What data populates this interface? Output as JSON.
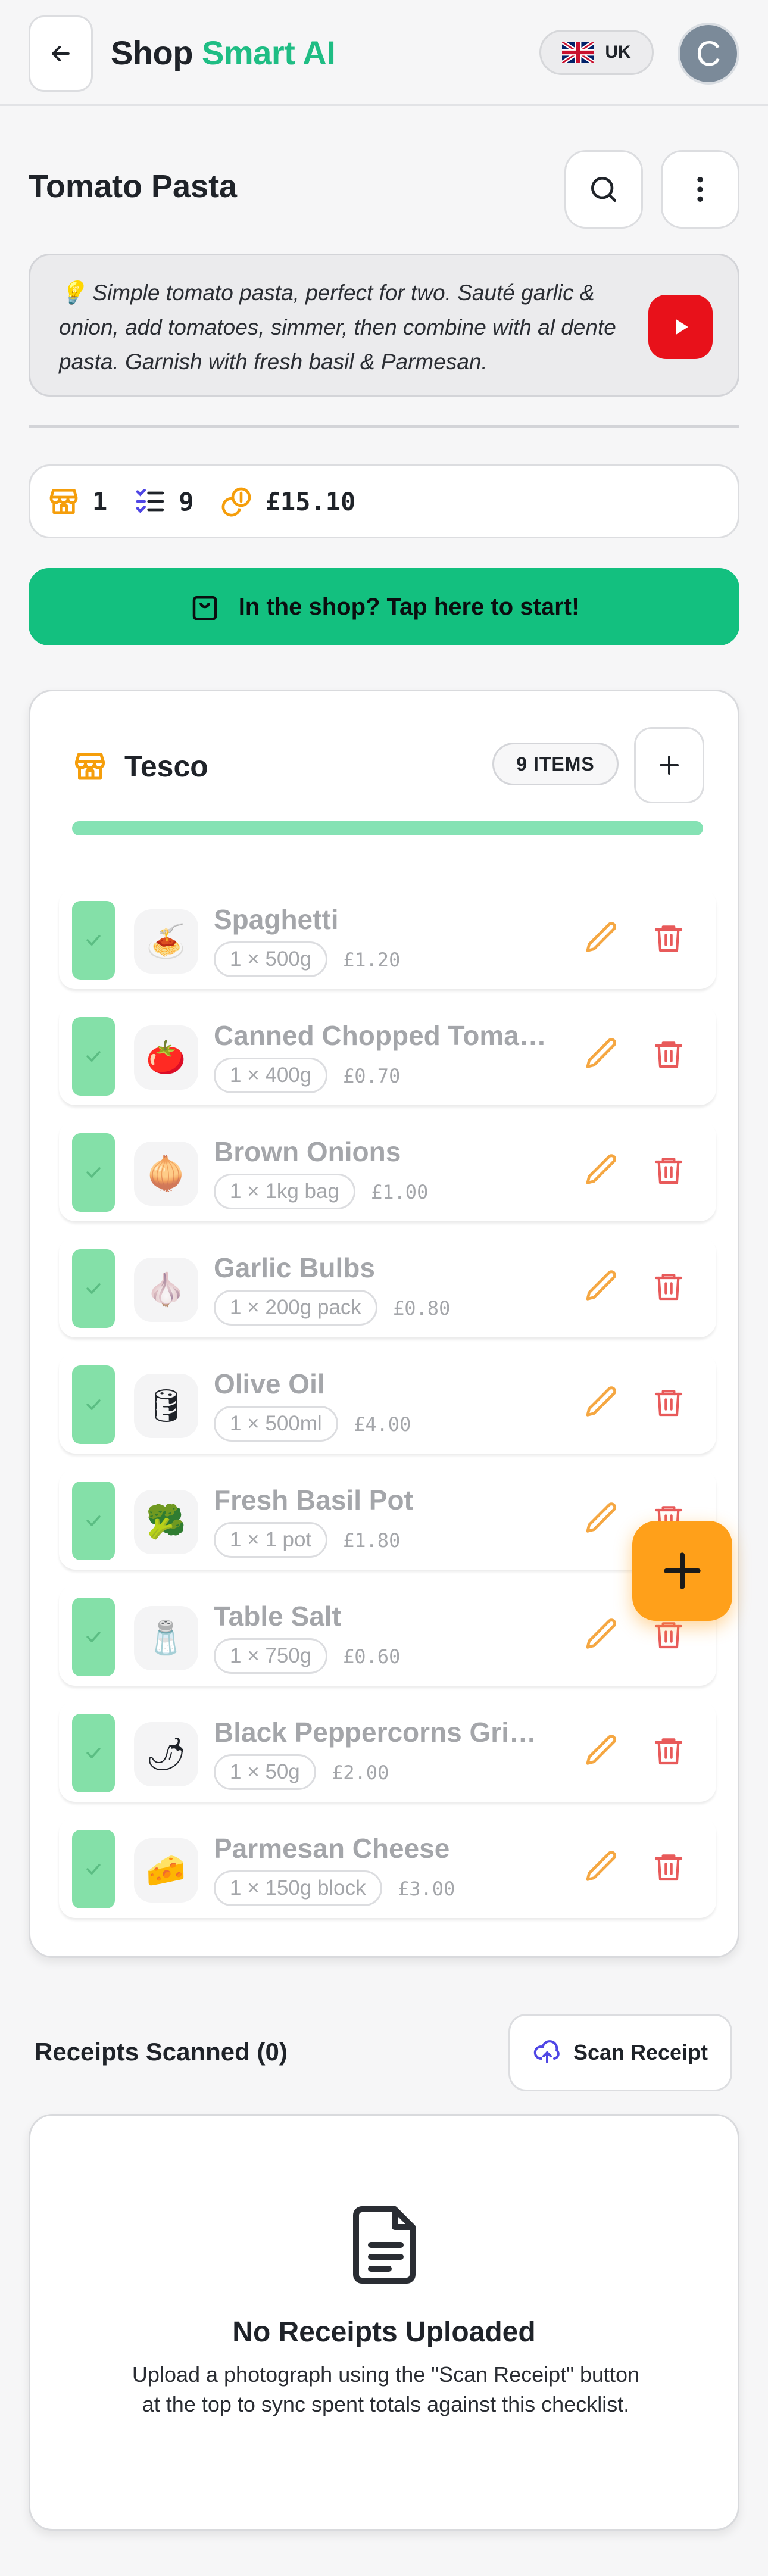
{
  "header": {
    "brand_main": "Shop",
    "brand_accent": "Smart AI",
    "country": "UK",
    "avatar_initial": "C"
  },
  "recipe": {
    "title": "Tomato Pasta",
    "description_icon": "lightbulb-icon",
    "description": "Simple tomato pasta, perfect for two. Sauté garlic & onion, add tomatoes, simmer, then combine with al dente pasta. Garnish with fresh basil & Parmesan."
  },
  "stats": {
    "shops": "1",
    "items": "9",
    "total": "£15.10"
  },
  "start_button": {
    "label": "In the shop? Tap here to start!"
  },
  "shop": {
    "name": "Tesco",
    "items_badge": "9 ITEMS",
    "progress": 1.0,
    "items": [
      {
        "name": "Spaghetti",
        "qty": "1 × 500g",
        "price": "£1.20",
        "emoji": "🍝",
        "checked": true
      },
      {
        "name": "Canned Chopped Tomatoes",
        "qty": "1 × 400g",
        "price": "£0.70",
        "emoji": "🍅",
        "checked": true
      },
      {
        "name": "Brown Onions",
        "qty": "1 × 1kg bag",
        "price": "£1.00",
        "emoji": "🧅",
        "checked": true
      },
      {
        "name": "Garlic Bulbs",
        "qty": "1 × 200g pack",
        "price": "£0.80",
        "emoji": "🧄",
        "checked": true
      },
      {
        "name": "Olive Oil",
        "qty": "1 × 500ml",
        "price": "£4.00",
        "emoji": "🛢",
        "checked": true
      },
      {
        "name": "Fresh Basil Pot",
        "qty": "1 × 1 pot",
        "price": "£1.80",
        "emoji": "🥦",
        "checked": true
      },
      {
        "name": "Table Salt",
        "qty": "1 × 750g",
        "price": "£0.60",
        "emoji": "🧂",
        "checked": true
      },
      {
        "name": "Black Peppercorns Grinder",
        "qty": "1 × 50g",
        "price": "£2.00",
        "emoji": "🌶",
        "checked": true
      },
      {
        "name": "Parmesan Cheese",
        "qty": "1 × 150g block",
        "price": "£3.00",
        "emoji": "🧀",
        "checked": true
      }
    ]
  },
  "receipts": {
    "title": "Receipts Scanned (0)",
    "scan_label": "Scan Receipt",
    "empty_title": "No Receipts Uploaded",
    "empty_text": "Upload a photograph using the \"Scan Receipt\" button at the top to sync spent totals against this checklist."
  },
  "colors": {
    "accent_green": "#1fbd84",
    "start_green": "#13c07f",
    "check_green": "#84e0a8",
    "orange": "#ffa01a",
    "delete_red": "#e85a5a"
  }
}
